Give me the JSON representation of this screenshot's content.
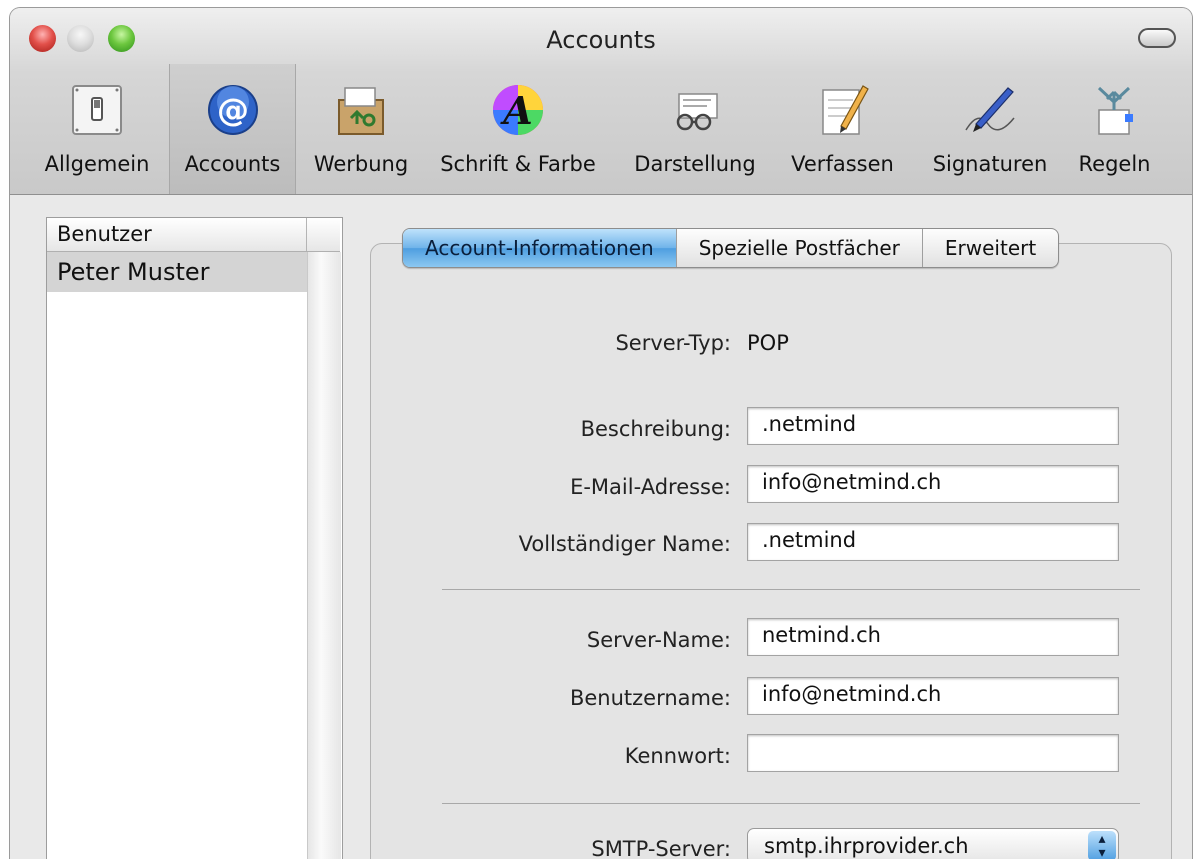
{
  "window": {
    "title": "Accounts"
  },
  "toolbar": {
    "items": [
      {
        "label": "Allgemein",
        "icon": "switch-icon"
      },
      {
        "label": "Accounts",
        "icon": "at-sign-icon"
      },
      {
        "label": "Werbung",
        "icon": "junk-mail-icon"
      },
      {
        "label": "Schrift & Farbe",
        "icon": "font-color-icon"
      },
      {
        "label": "Darstellung",
        "icon": "glasses-icon"
      },
      {
        "label": "Verfassen",
        "icon": "compose-pencil-icon"
      },
      {
        "label": "Signaturen",
        "icon": "signature-pen-icon"
      },
      {
        "label": "Regeln",
        "icon": "rules-arrows-icon"
      }
    ],
    "selected": "Accounts"
  },
  "accounts_list": {
    "header": "Benutzer",
    "rows": [
      "Peter Muster"
    ]
  },
  "tabs": [
    "Account-Informationen",
    "Spezielle Postfächer",
    "Erweitert"
  ],
  "form": {
    "server_type_label": "Server-Typ:",
    "server_type_value": "POP",
    "description_label": "Beschreibung:",
    "description_value": ".netmind",
    "email_label": "E-Mail-Adresse:",
    "email_value": "info@netmind.ch",
    "fullname_label": "Vollständiger Name:",
    "fullname_value": ".netmind",
    "servername_label": "Server-Name:",
    "servername_value": "netmind.ch",
    "username_label": "Benutzername:",
    "username_value": "info@netmind.ch",
    "password_label": "Kennwort:",
    "password_value": "",
    "smtp_label": "SMTP-Server:",
    "smtp_value": "smtp.ihrprovider.ch"
  }
}
